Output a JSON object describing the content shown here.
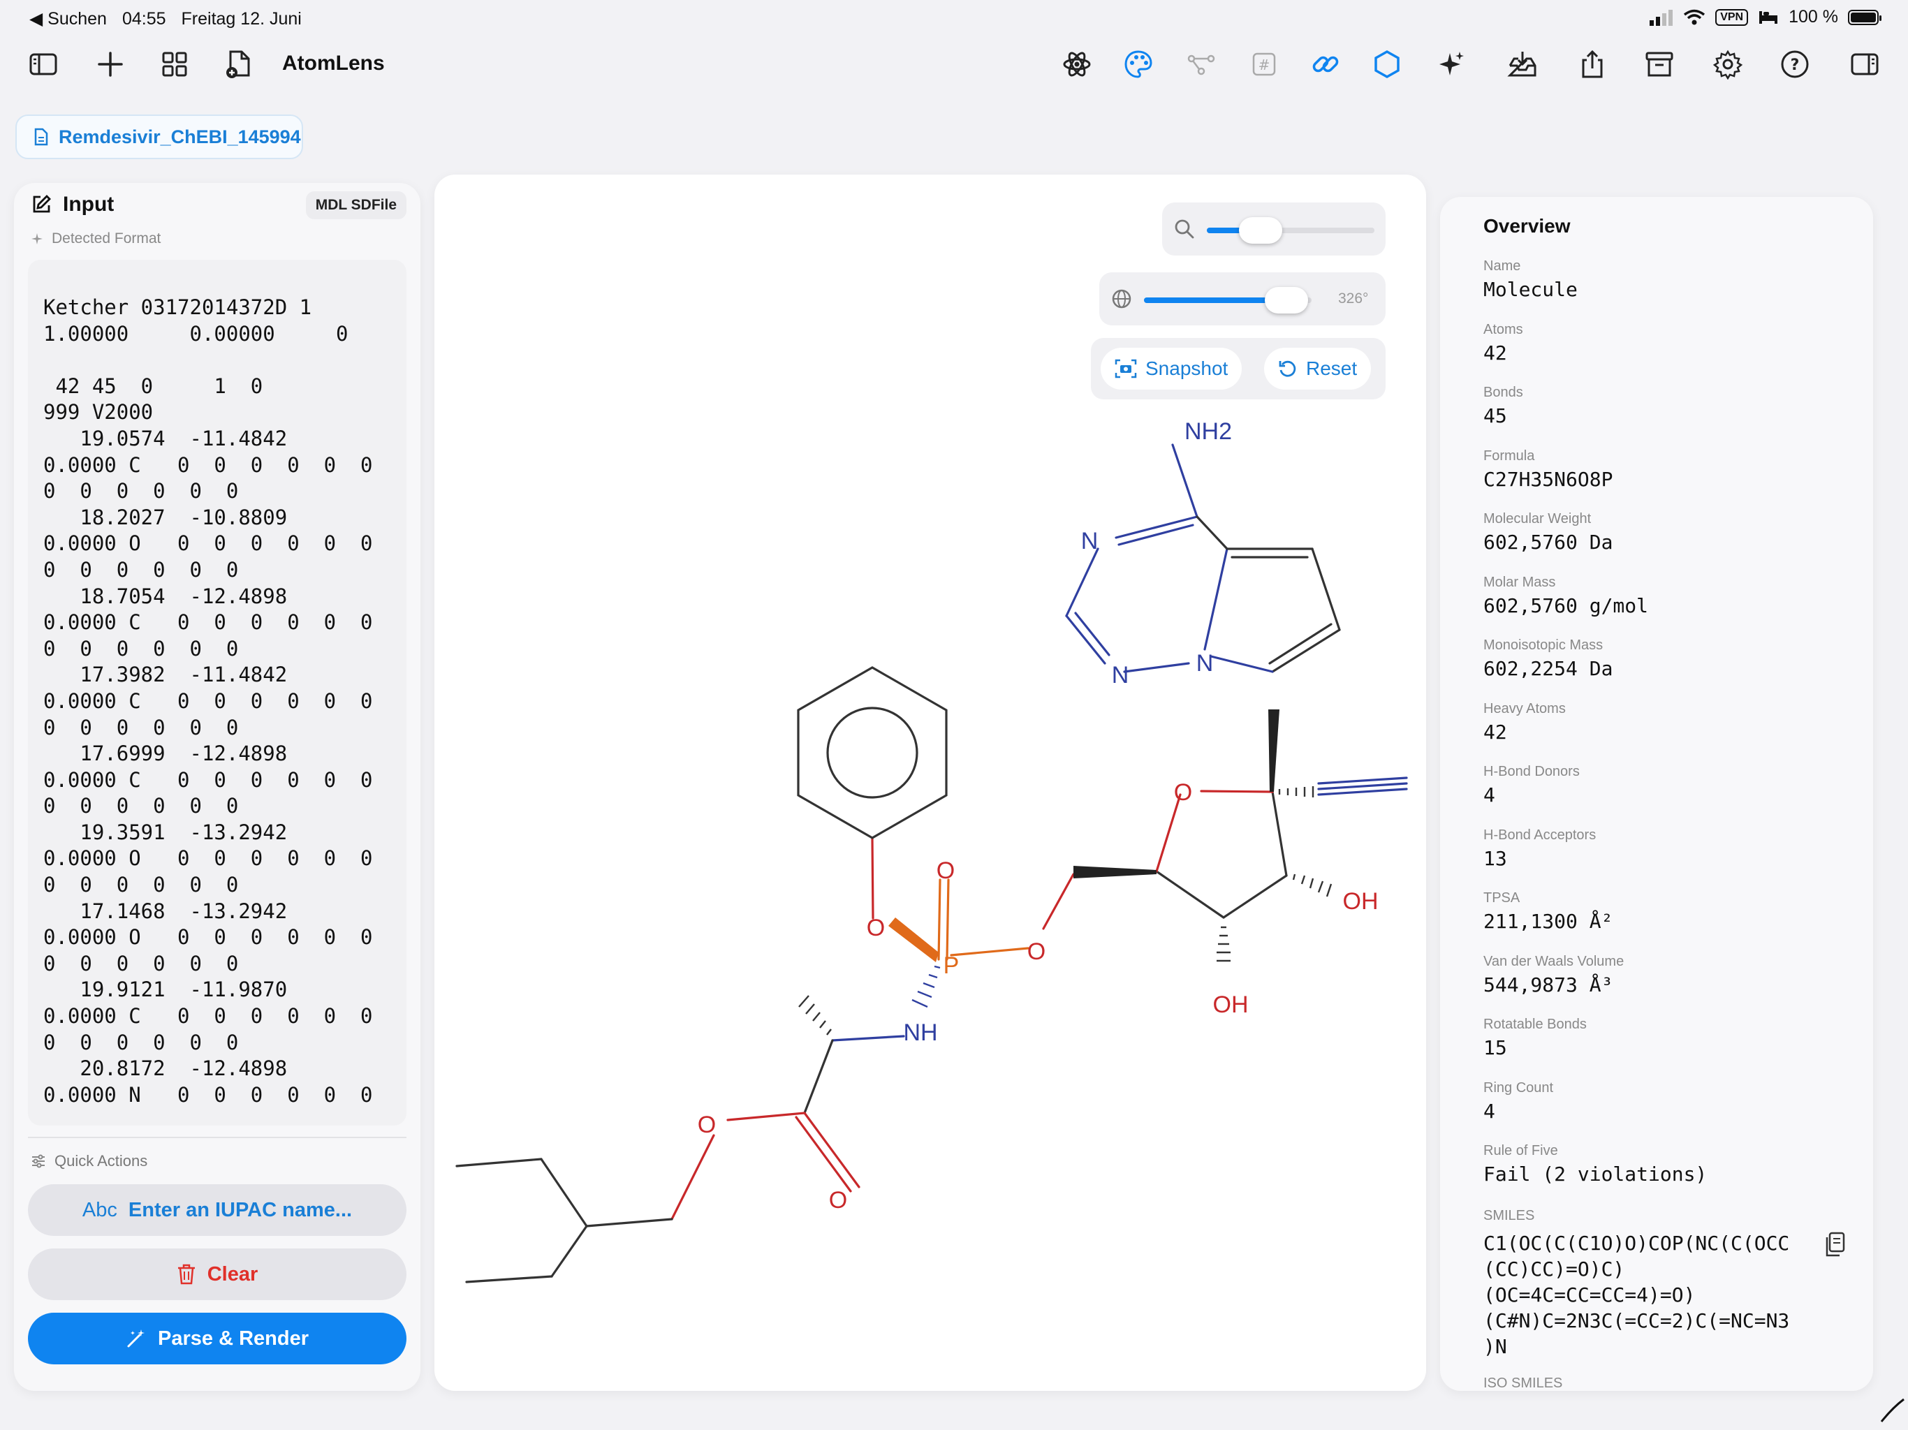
{
  "status_bar": {
    "back": "◀ Suchen",
    "time": "04:55",
    "date": "Freitag 12. Juni",
    "vpn": "VPN",
    "battery": "100 %"
  },
  "app": {
    "title": "AtomLens"
  },
  "toolbar_icons": [
    "sidebar-left-icon",
    "plus-icon",
    "grid-icon",
    "new-document-icon",
    "atom-icon",
    "palette-icon",
    "nodes-icon",
    "hash-icon",
    "link-icon",
    "hexagon-icon",
    "sparkles-icon",
    "tray-download-icon",
    "share-icon",
    "archive-icon",
    "gear-icon",
    "help-icon",
    "sidebar-right-icon"
  ],
  "document": {
    "name": "Remdesivir_ChEBI_145994"
  },
  "input": {
    "title": "Input",
    "format": "MDL SDFile",
    "detected_label": "Detected Format",
    "content": "Ketcher 03172014372D 1\n1.00000     0.00000     0\n\n 42 45  0     1  0\n999 V2000\n   19.0574  -11.4842\n0.0000 C   0  0  0  0  0  0\n0  0  0  0  0  0\n   18.2027  -10.8809\n0.0000 O   0  0  0  0  0  0\n0  0  0  0  0  0\n   18.7054  -12.4898\n0.0000 C   0  0  0  0  0  0\n0  0  0  0  0  0\n   17.3982  -11.4842\n0.0000 C   0  0  0  0  0  0\n0  0  0  0  0  0\n   17.6999  -12.4898\n0.0000 C   0  0  0  0  0  0\n0  0  0  0  0  0\n   19.3591  -13.2942\n0.0000 O   0  0  0  0  0  0\n0  0  0  0  0  0\n   17.1468  -13.2942\n0.0000 O   0  0  0  0  0  0\n0  0  0  0  0  0\n   19.9121  -11.9870\n0.0000 C   0  0  0  0  0  0\n0  0  0  0  0  0\n   20.8172  -12.4898\n0.0000 N   0  0  0  0  0  0"
  },
  "quick_actions": {
    "label": "Quick Actions",
    "iupac_prefix": "Abc",
    "iupac_placeholder": "Enter an IUPAC name...",
    "clear": "Clear",
    "parse": "Parse & Render"
  },
  "viewer": {
    "zoom": 0.32,
    "rotation": 0.85,
    "rotation_label": "326°",
    "snapshot": "Snapshot",
    "reset": "Reset",
    "atoms": {
      "nh2": "NH2",
      "n1": "N",
      "n2": "N",
      "n3": "N",
      "o_ring": "O",
      "oh1": "OH",
      "oh2": "OH",
      "p": "P",
      "o_dbl": "O",
      "o_phen": "O",
      "o_link": "O",
      "nh": "NH",
      "o_ester": "O",
      "o_carb": "O"
    }
  },
  "overview": {
    "title": "Overview",
    "items": [
      {
        "label": "Name",
        "value": "Molecule"
      },
      {
        "label": "Atoms",
        "value": "42"
      },
      {
        "label": "Bonds",
        "value": "45"
      },
      {
        "label": "Formula",
        "value": "C27H35N6O8P"
      },
      {
        "label": "Molecular Weight",
        "value": "602,5760 Da"
      },
      {
        "label": "Molar Mass",
        "value": "602,5760 g/mol"
      },
      {
        "label": "Monoisotopic Mass",
        "value": "602,2254 Da"
      },
      {
        "label": "Heavy Atoms",
        "value": "42"
      },
      {
        "label": "H-Bond Donors",
        "value": "4"
      },
      {
        "label": "H-Bond Acceptors",
        "value": "13"
      },
      {
        "label": "TPSA",
        "value": "211,1300 Å²"
      },
      {
        "label": "Van der Waals Volume",
        "value": "544,9873 Å³"
      },
      {
        "label": "Rotatable Bonds",
        "value": "15"
      },
      {
        "label": "Ring Count",
        "value": "4"
      },
      {
        "label": "Rule of Five",
        "value": "Fail (2 violations)"
      }
    ],
    "smiles_label": "SMILES",
    "smiles": "C1(OC(C(C1O)O)COP(NC(C(OCC\n(CC)CC)=O)C)\n(OC=4C=CC=CC=4)=O)\n(C#N)C=2N3C(=CC=2)C(=NC=N3\n)N",
    "iso_smiles_label": "ISO SMILES"
  },
  "colors": {
    "accent": "#0f84f0",
    "danger": "#e0302a",
    "nitrogen": "#2f3fa0",
    "oxygen": "#c8282a",
    "phosphorus": "#e06a1a"
  }
}
